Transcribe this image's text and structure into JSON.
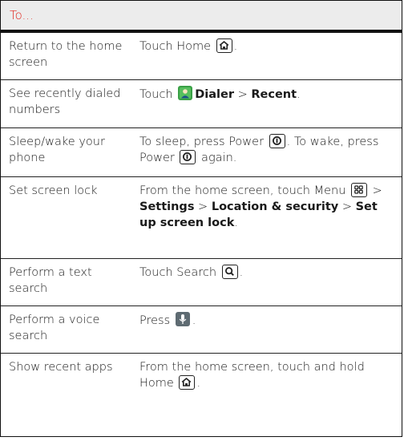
{
  "header": "To...",
  "rows": [
    {
      "action": "Return to the home screen",
      "parts": [
        {
          "t": "Touch Home "
        },
        {
          "icon": "home-key-icon"
        },
        {
          "t": "."
        }
      ]
    },
    {
      "action": "See recently dialed numbers",
      "parts": [
        {
          "t": "Touch "
        },
        {
          "icon": "dialer-app-icon"
        },
        {
          "b": "Dialer"
        },
        {
          "t": " > "
        },
        {
          "b": "Recent"
        },
        {
          "t": "."
        }
      ]
    },
    {
      "action": "Sleep/wake your phone",
      "parts": [
        {
          "t": "To sleep, press Power "
        },
        {
          "icon": "power-key-icon"
        },
        {
          "t": ". To wake, press Power "
        },
        {
          "icon": "power-key-icon"
        },
        {
          "t": " again."
        }
      ]
    },
    {
      "action": "Set screen lock",
      "parts": [
        {
          "t": "From the home screen, touch Menu "
        },
        {
          "icon": "menu-key-icon"
        },
        {
          "t": " > "
        },
        {
          "b": "Settings"
        },
        {
          "t": " > "
        },
        {
          "b": "Location & security"
        },
        {
          "t": " > "
        },
        {
          "b": "Set up screen lock"
        },
        {
          "t": "."
        }
      ]
    },
    {
      "action": "Perform a text search",
      "parts": [
        {
          "t": "Touch Search "
        },
        {
          "icon": "search-key-icon"
        },
        {
          "t": "."
        }
      ]
    },
    {
      "action": "Perform a voice search",
      "parts": [
        {
          "t": "Press "
        },
        {
          "icon": "voice-search-icon"
        },
        {
          "t": "."
        }
      ]
    },
    {
      "action": "Show recent apps",
      "parts": [
        {
          "t": "From the home screen, touch and hold Home "
        },
        {
          "icon": "home-key-icon"
        },
        {
          "t": "."
        }
      ]
    }
  ],
  "colors": {
    "header_text": "#e2261d",
    "header_bg": "#ececec",
    "dialer_green": "#3aa046",
    "voice_gray": "#5e6b72"
  }
}
